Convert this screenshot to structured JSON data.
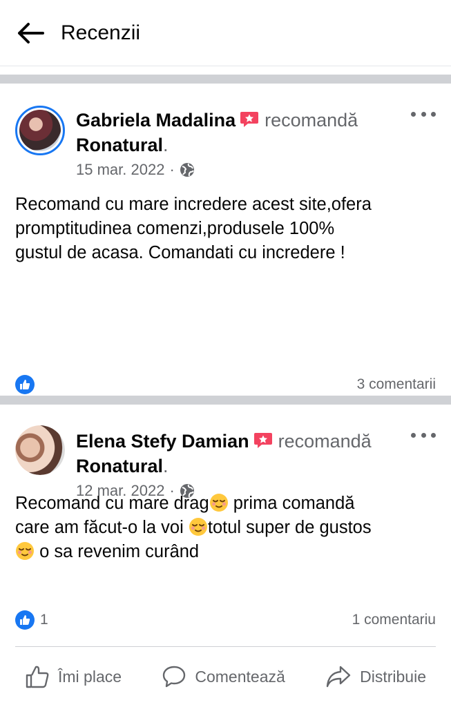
{
  "header": {
    "title": "Recenzii",
    "back_icon": "arrow-left-icon"
  },
  "posts": [
    {
      "author": "Gabriela Madalina",
      "action": "recomandă",
      "page": "Ronatural",
      "page_dot": ".",
      "date": "15 mar. 2022",
      "privacy_icon": "globe-icon",
      "text_lines": [
        "Recomand cu mare incredere  acest site,ofera",
        "promptitudinea comenzi,produsele 100%",
        "gustul de acasa. Comandati cu incredere !"
      ],
      "reaction_count": "",
      "comments": "3 comentarii"
    },
    {
      "author": "Elena Stefy Damian",
      "action": "recomandă",
      "page": "Ronatural",
      "page_dot": ".",
      "date": "12 mar. 2022",
      "privacy_icon": "globe-icon",
      "text_segments": [
        "Recomand cu mare drag",
        " prima comandă",
        "care am făcut-o la voi ",
        "totul super de gustos",
        " o sa revenim curând"
      ],
      "emoji_icon": "relieved-face-emoji",
      "reaction_count": "1",
      "comments": "1 comentariu"
    }
  ],
  "actions": {
    "like": "Îmi place",
    "comment": "Comentează",
    "share": "Distribuie"
  },
  "colors": {
    "brand_blue": "#1877f2",
    "secondary_text": "#65676b",
    "separator": "#cfd1d5",
    "recommend_red": "#f3425f"
  }
}
